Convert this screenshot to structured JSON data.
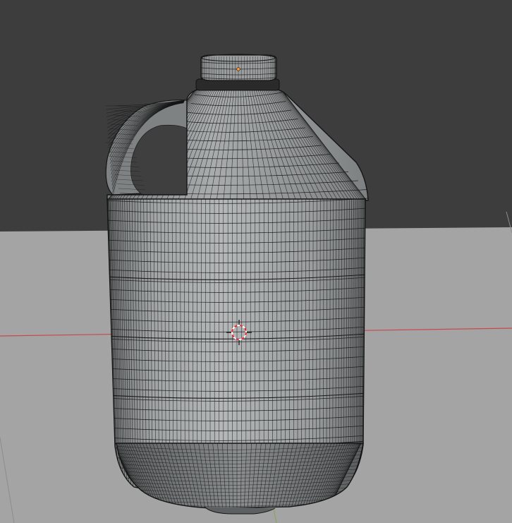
{
  "viewport": {
    "mode": "3d-viewport-wireframe-over-solid",
    "object": "gallon-jug-mesh"
  },
  "colors": {
    "backdrop": "#3d3d3d",
    "floor": "#a3a3a3",
    "mesh_fill": "#8f9293",
    "mesh_fill_light": "#b1b4b5",
    "mesh_fill_dark": "#5e6162",
    "wire": "#141414",
    "axis_x": "#c8484c",
    "axis_y": "#8aa35c",
    "cursor_red": "#e8232f",
    "cursor_white": "#ffffff",
    "origin": "#ff9a2e"
  },
  "icons": {
    "cursor": "3d-cursor-icon",
    "origin": "object-origin-icon"
  }
}
